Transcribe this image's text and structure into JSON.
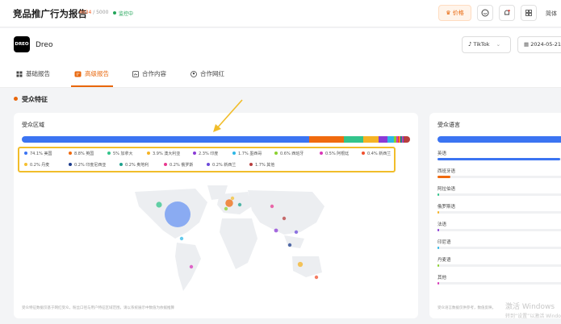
{
  "topbar": {
    "title": "竞品推广行为报告",
    "quota_used": "4634",
    "quota_total": " / 5000",
    "monitor_status": "监控中",
    "price_label": "价格",
    "user_label": "简体"
  },
  "brand": {
    "logo_text": "DREO",
    "name": "Dreo"
  },
  "filters": {
    "platform": "TikTok",
    "date": "2024-05-21"
  },
  "tabs": [
    {
      "label": "基础报告"
    },
    {
      "label": "高级报告"
    },
    {
      "label": "合作内容"
    },
    {
      "label": "合作网红"
    }
  ],
  "section": {
    "title": "受众特征"
  },
  "region_card": {
    "title": "受众区域",
    "footnote": "受众特征数据仅基于网红受众，粉丝口径与用户特征区域范围，请以系统展示中数值为依据推算",
    "legend": [
      {
        "pct": "74.1%",
        "name": "美国",
        "color": "#3b74f2"
      },
      {
        "pct": "8.8%",
        "name": "英国",
        "color": "#f06a0e"
      },
      {
        "pct": "5%",
        "name": "加拿大",
        "color": "#33c48b"
      },
      {
        "pct": "3.9%",
        "name": "澳大利亚",
        "color": "#f5b324"
      },
      {
        "pct": "2.3%",
        "name": "印度",
        "color": "#8a3ad6"
      },
      {
        "pct": "1.7%",
        "name": "墨西哥",
        "color": "#2db7e6"
      },
      {
        "pct": "0.6%",
        "name": "西班牙",
        "color": "#8bd12f"
      },
      {
        "pct": "0.5%",
        "name": "阿根廷",
        "color": "#d936b8"
      },
      {
        "pct": "0.4%",
        "name": "新西兰",
        "color": "#f0502e"
      },
      {
        "pct": "0.2%",
        "name": "丹麦",
        "color": "#f5c030"
      },
      {
        "pct": "0.2%",
        "name": "印度尼西亚",
        "color": "#1c3c8c"
      },
      {
        "pct": "0.2%",
        "name": "奥地利",
        "color": "#1da18d"
      },
      {
        "pct": "0.2%",
        "name": "俄罗斯",
        "color": "#e8388f"
      },
      {
        "pct": "0.2%",
        "name": "新西兰",
        "color": "#6c4ad9"
      },
      {
        "pct": "1.7%",
        "name": "其他",
        "color": "#b83e3e"
      }
    ]
  },
  "language_card": {
    "title": "受众语言",
    "footnote": "受众语言数据仅供参考，数值反映，",
    "items": [
      {
        "name": "英语",
        "value": 0.95,
        "color": "#3b74f2"
      },
      {
        "name": "西班牙语",
        "value": 0.1,
        "color": "#f06a0e"
      },
      {
        "name": "阿拉伯语",
        "value": 0.015,
        "color": "#33c48b"
      },
      {
        "name": "俄罗斯语",
        "value": 0.012,
        "color": "#f5b324"
      },
      {
        "name": "法语",
        "value": 0.01,
        "color": "#8a3ad6"
      },
      {
        "name": "印尼语",
        "value": 0.008,
        "color": "#2db7e6"
      },
      {
        "name": "丹麦语",
        "value": 0.006,
        "color": "#8bd12f"
      },
      {
        "name": "其他",
        "value": 0.012,
        "color": "#d936b8"
      }
    ]
  },
  "watermark": {
    "line1": "激活 Windows",
    "line2": "转到“设置”以激活 Windows。"
  }
}
